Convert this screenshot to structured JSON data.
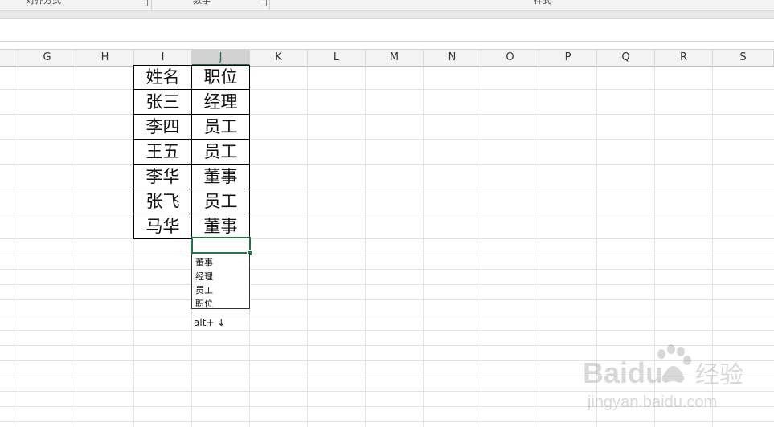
{
  "ribbon": {
    "groups": [
      {
        "label": "对齐方式"
      },
      {
        "label": "数字"
      },
      {
        "label": "样式"
      }
    ]
  },
  "columns": [
    "G",
    "H",
    "I",
    "J",
    "K",
    "L",
    "M",
    "N",
    "O",
    "P",
    "Q",
    "R",
    "S"
  ],
  "selected_column": "J",
  "table": {
    "header": {
      "name": "姓名",
      "title": "职位"
    },
    "rows": [
      {
        "name": "张三",
        "title": "经理"
      },
      {
        "name": "李四",
        "title": "员工"
      },
      {
        "name": "王五",
        "title": "员工"
      },
      {
        "name": "李华",
        "title": "董事"
      },
      {
        "name": "张飞",
        "title": "员工"
      },
      {
        "name": "马华",
        "title": "董事"
      }
    ]
  },
  "dropdown": {
    "items": [
      "董事",
      "经理",
      "员工",
      "职位"
    ]
  },
  "hint": {
    "text": "alt+",
    "arrow": "↓"
  },
  "watermark": {
    "brand": "Baidu",
    "suffix": "经验",
    "url": "jingyan.baidu.com"
  },
  "colors": {
    "accent": "#217346",
    "gridline": "#e1e1e1",
    "header_bg": "#f3f3f3"
  }
}
